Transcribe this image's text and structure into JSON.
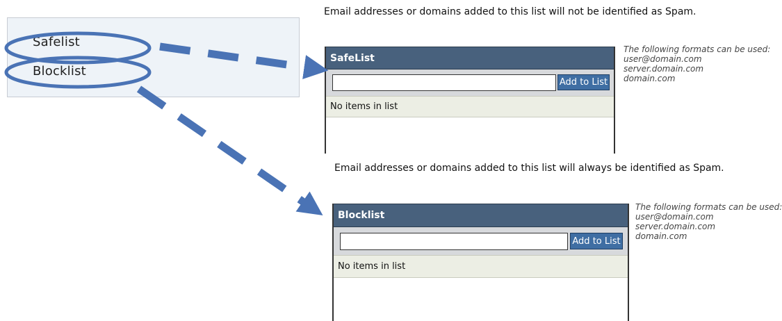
{
  "nav": {
    "items": [
      {
        "label": "Safelist"
      },
      {
        "label": "Blocklist"
      }
    ]
  },
  "safelist": {
    "description": "Email addresses or domains added to this list will not be identified as Spam.",
    "title": "SafeList",
    "input_value": "",
    "button_label": "Add to List",
    "empty_text": "No items in list",
    "formats_heading": "The following formats can be used:",
    "formats": [
      "user@domain.com",
      "server.domain.com",
      "domain.com"
    ]
  },
  "blocklist": {
    "description": "Email addresses or domains added to this list will always be identified as Spam.",
    "title": "Blocklist",
    "input_value": "",
    "button_label": "Add to List",
    "empty_text": "No items in list",
    "formats_heading": "The following formats can be used:",
    "formats": [
      "user@domain.com",
      "server.domain.com",
      "domain.com"
    ]
  },
  "colors": {
    "panel_header": "#48617d",
    "button": "#3f6ea3",
    "annotation": "#4a73b5"
  },
  "annotations": {
    "highlight": "ellipse",
    "connector": "dashed-arrow"
  }
}
